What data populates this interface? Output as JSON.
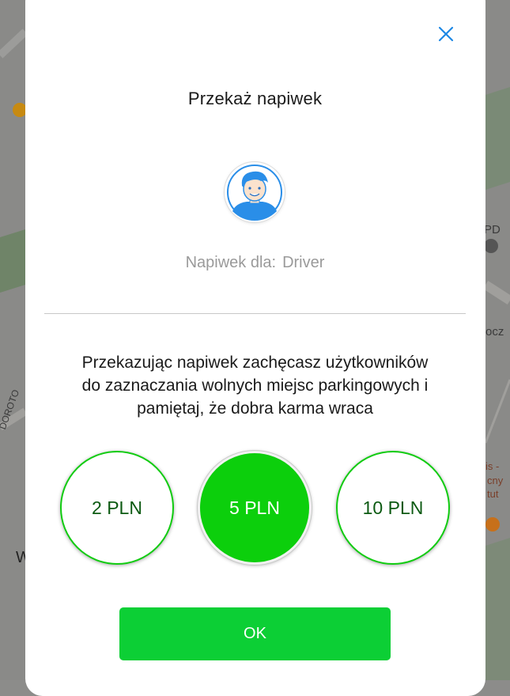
{
  "map": {
    "labels": [
      "PD",
      "ocz",
      "is -",
      "cny",
      "tut",
      "DOROTO",
      "W"
    ]
  },
  "dialog": {
    "title": "Przekaż napiwek",
    "recipient_prefix": "Napiwek dla:",
    "recipient_name": "Driver",
    "message_lines": [
      "Przekazując napiwek zachęcasz użytkowników",
      "do zaznaczania wolnych miejsc parkingowych i",
      "pamiętaj, że dobra karma wraca"
    ],
    "amounts": [
      "2 PLN",
      "5 PLN",
      "10 PLN"
    ],
    "selected_amount": "5 PLN",
    "ok_label": "OK"
  },
  "colors": {
    "accent_green": "#0ccf0c",
    "ok_green": "#0ccf35",
    "close_blue": "#1e88e5",
    "amount_text_dark": "#0c5a12"
  },
  "icons": {
    "close": "close-icon",
    "avatar": "driver-avatar-icon"
  }
}
